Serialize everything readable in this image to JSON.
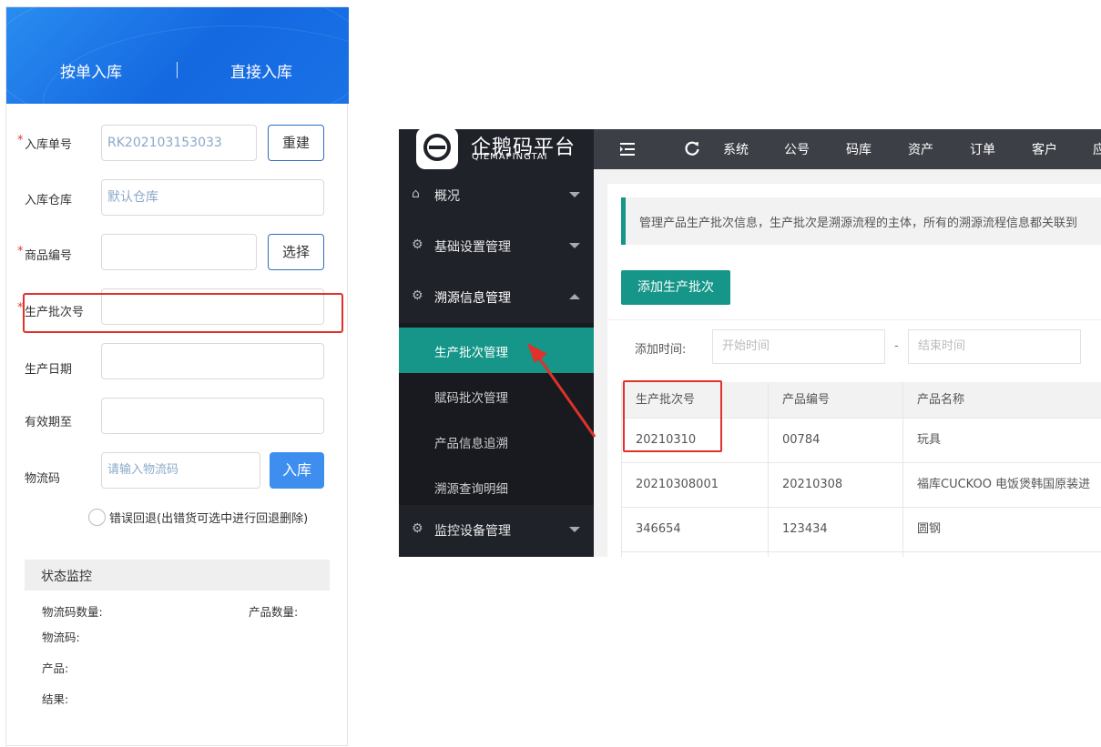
{
  "phone": {
    "tabs": [
      "按单入库",
      "直接入库"
    ],
    "fields": {
      "order_no": {
        "label": "入库单号",
        "value": "RK202103153033",
        "button": "重建",
        "required": "*"
      },
      "warehouse": {
        "label": "入库仓库",
        "value": "默认仓库"
      },
      "product_code": {
        "label": "商品编号",
        "value": "",
        "button": "选择",
        "required": "*"
      },
      "batch_no": {
        "label": "生产批次号",
        "value": "",
        "required": "*"
      },
      "prod_date": {
        "label": "生产日期",
        "value": ""
      },
      "expiry": {
        "label": "有效期至",
        "value": ""
      },
      "logistics": {
        "label": "物流码",
        "placeholder": "请输入物流码",
        "button": "入库"
      }
    },
    "rollback_label": "错误回退(出错货可选中进行回退删除)",
    "status": {
      "title": "状态监控",
      "logistics_count": "物流码数量:",
      "product_count": "产品数量:",
      "logistics_code": "物流码:",
      "product": "产品:",
      "result": "结果:"
    }
  },
  "admin": {
    "logo": {
      "title": "企鹅码平台",
      "subtitle": "QIEMAPINGTAI"
    },
    "topbar": [
      "系统",
      "公号",
      "码库",
      "资产",
      "订单",
      "客户",
      "应"
    ],
    "menu": [
      {
        "icon": "home-icon",
        "glyph": "⌂",
        "label": "概况",
        "arrow": "down"
      },
      {
        "icon": "gear-icon",
        "glyph": "⚙",
        "label": "基础设置管理",
        "arrow": "down"
      },
      {
        "icon": "gear-icon",
        "glyph": "⚙",
        "label": "溯源信息管理",
        "arrow": "up"
      }
    ],
    "submenu": [
      "生产批次管理",
      "赋码批次管理",
      "产品信息追溯",
      "溯源查询明细"
    ],
    "menu_bottom": {
      "icon": "gear-icon",
      "glyph": "⚙",
      "label": "监控设备管理"
    },
    "notice": "管理产品生产批次信息，生产批次是溯源流程的主体，所有的溯源流程信息都关联到",
    "add_button": "添加生产批次",
    "filter": {
      "label": "添加时间:",
      "start": "开始时间",
      "separator": "-",
      "end": "结束时间"
    },
    "table": {
      "headers": [
        "生产批次号",
        "产品编号",
        "产品名称"
      ],
      "rows": [
        [
          "20210310",
          "00784",
          "玩具"
        ],
        [
          "20210308001",
          "20210308",
          "福库CUCKOO 电饭煲韩国原装进"
        ],
        [
          "346654",
          "123434",
          "圆钢"
        ]
      ]
    }
  }
}
